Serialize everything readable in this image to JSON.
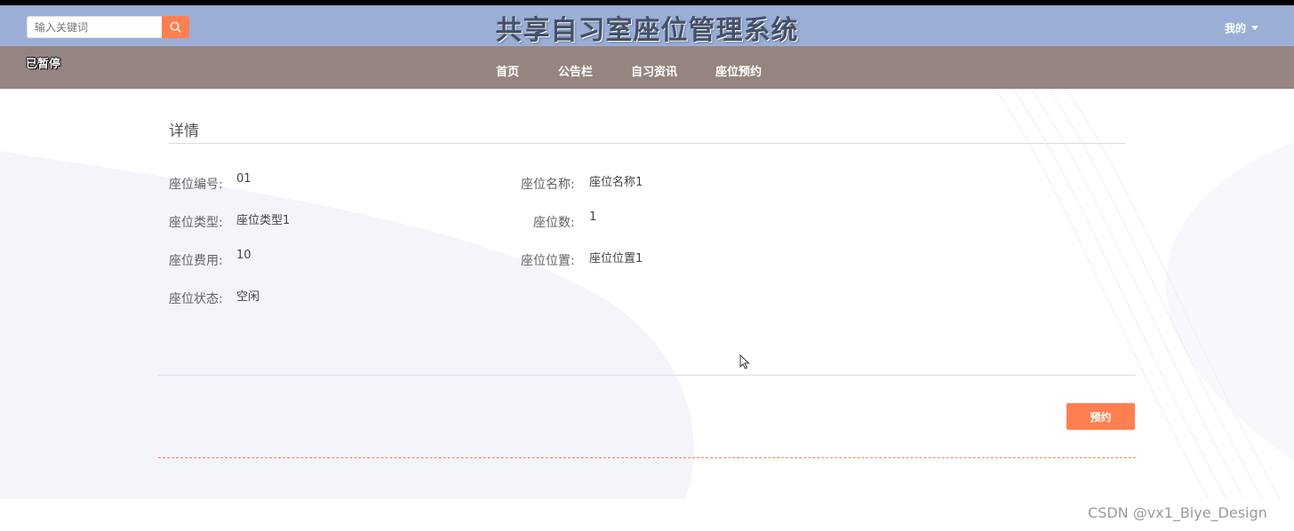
{
  "header": {
    "search_placeholder": "输入关键词",
    "site_title": "共享自习室座位管理系统",
    "user_menu_label": "我的"
  },
  "nav": {
    "status_text": "已暂停",
    "items": [
      {
        "label": "首页"
      },
      {
        "label": "公告栏"
      },
      {
        "label": "自习资讯"
      },
      {
        "label": "座位预约"
      }
    ]
  },
  "detail": {
    "title": "详情",
    "fields": {
      "seat_number": {
        "label": "座位编号:",
        "value": "01"
      },
      "seat_name": {
        "label": "座位名称:",
        "value": "座位名称1"
      },
      "seat_type": {
        "label": "座位类型:",
        "value": "座位类型1"
      },
      "seat_count": {
        "label": "座位数:",
        "value": "1"
      },
      "seat_fee": {
        "label": "座位费用:",
        "value": "10"
      },
      "seat_location": {
        "label": "座位位置:",
        "value": "座位位置1"
      },
      "seat_status": {
        "label": "座位状态:",
        "value": "空闲"
      }
    },
    "reserve_button": "预约"
  },
  "watermark": "CSDN @vx1_Biye_Design",
  "colors": {
    "header_bg": "#9aaed6",
    "nav_bg": "#958580",
    "accent": "#ff7f50"
  }
}
